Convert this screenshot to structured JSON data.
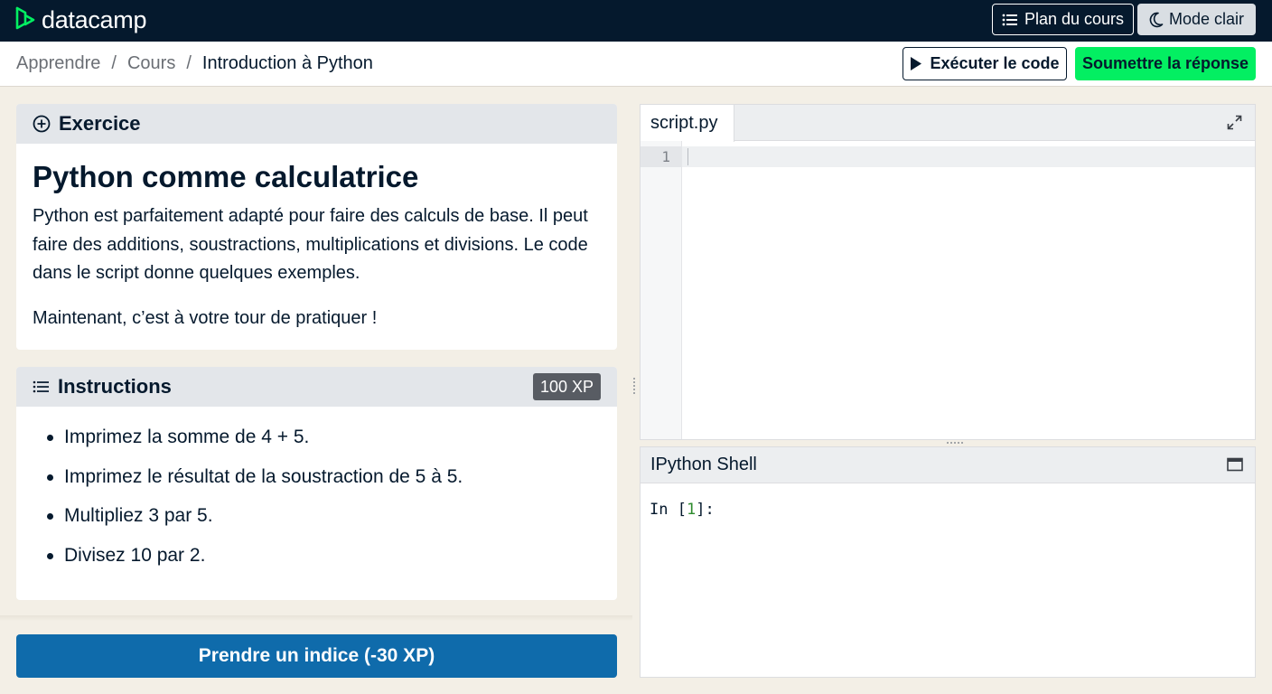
{
  "app": {
    "brand": "datacamp",
    "brand_color": "#03ef62",
    "topbar_color": "#05192d"
  },
  "topbar": {
    "plan_label": "Plan du cours",
    "plan_icon": "list-icon",
    "mode_label": "Mode clair",
    "mode_icon": "moon-icon"
  },
  "breadcrumb": {
    "items": [
      "Apprendre",
      "Cours",
      "Introduction à Python"
    ],
    "separator": "/"
  },
  "actions": {
    "run_label": "Exécuter le code",
    "run_icon": "play-icon",
    "submit_label": "Soumettre la réponse",
    "submit_color": "#03ef62"
  },
  "exercise": {
    "header": "Exercice",
    "header_icon": "plus-circle-icon",
    "title": "Python comme calculatrice",
    "paragraph1": "Python est parfaitement adapté pour faire des calculs de base. Il peut faire des additions, soustractions, multiplications et divisions. Le code dans le script donne quelques exemples.",
    "paragraph2": "Maintenant, c’est à votre tour de pratiquer !"
  },
  "instructions": {
    "header": "Instructions",
    "header_icon": "list-icon",
    "xp": "100 XP",
    "items": [
      "Imprimez la somme de 4 + 5.",
      "Imprimez le résultat de la soustraction de 5 à 5.",
      "Multipliez 3 par 5.",
      "Divisez 10 par 2."
    ]
  },
  "hint": {
    "label": "Prendre un indice (-30 XP)",
    "color": "#0f6bab"
  },
  "editor": {
    "tab": "script.py",
    "line_numbers": [
      "1"
    ],
    "expand_icon": "expand-icon"
  },
  "shell": {
    "title": "IPython Shell",
    "window_icon": "window-icon",
    "prompt_prefix": "In [",
    "prompt_number": "1",
    "prompt_suffix": "]:"
  }
}
